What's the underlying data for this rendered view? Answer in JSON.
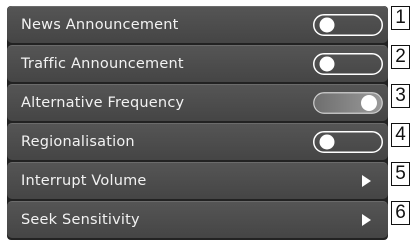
{
  "colors": {
    "row_background": "#4f4f4f",
    "toggle_on_fill": "#7a7a7a",
    "text": "#f2f2f2"
  },
  "settings": [
    {
      "label": "News Announcement",
      "control": "toggle",
      "state": "off",
      "callout": "1"
    },
    {
      "label": "Traffic Announcement",
      "control": "toggle",
      "state": "off",
      "callout": "2"
    },
    {
      "label": "Alternative Frequency",
      "control": "toggle",
      "state": "on",
      "callout": "3"
    },
    {
      "label": "Regionalisation",
      "control": "toggle",
      "state": "off",
      "callout": "4"
    },
    {
      "label": "Interrupt Volume",
      "control": "submenu-arrow",
      "callout": "5"
    },
    {
      "label": "Seek Sensitivity",
      "control": "submenu-arrow",
      "callout": "6"
    }
  ]
}
